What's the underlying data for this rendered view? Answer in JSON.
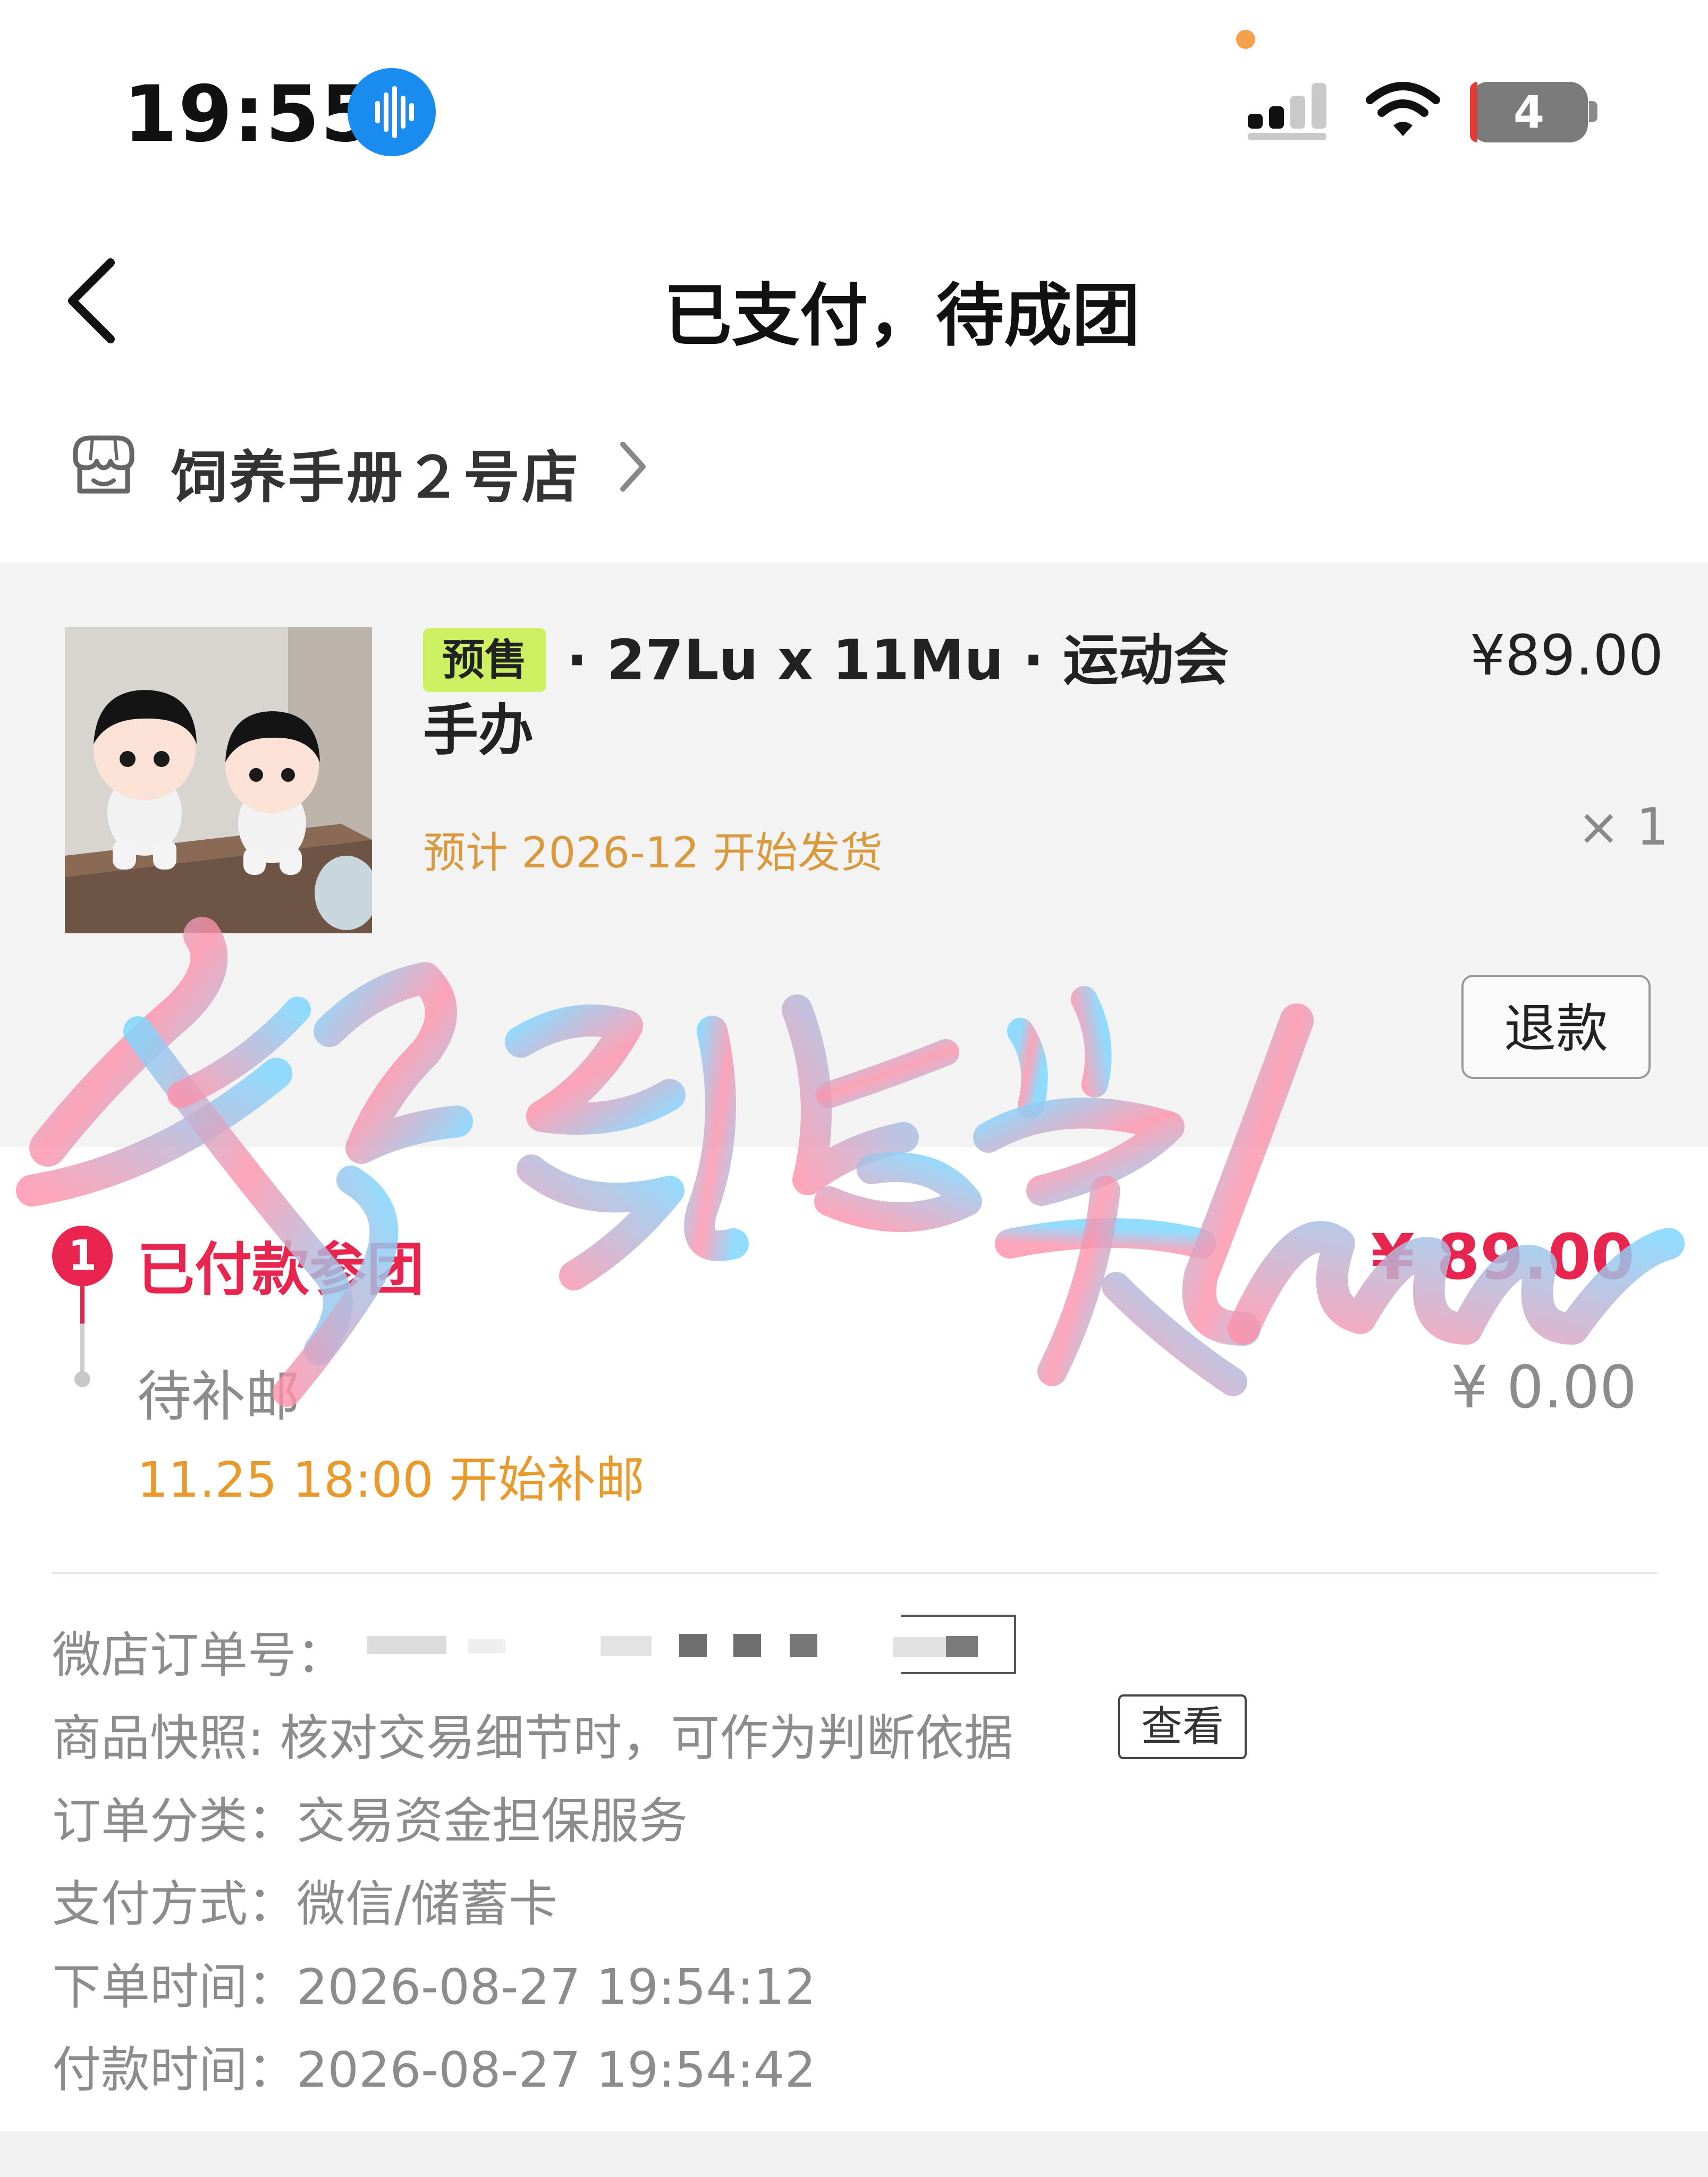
{
  "status_bar": {
    "time": "19:55",
    "battery_level": "4",
    "icons": [
      "voice-assistant-icon",
      "signal-icon",
      "wifi-icon",
      "battery-icon"
    ]
  },
  "nav": {
    "title": "已支付，待成团",
    "back_icon": "chevron-left-icon"
  },
  "shop": {
    "name": "饲养手册２号店",
    "icon": "storefront-icon"
  },
  "product": {
    "tag": "预售",
    "title": "· 27Lu x 11Mu · 运动会手办",
    "price": "¥89.00",
    "shipping_estimate": "预计 2026-12 开始发货",
    "quantity": "× 1",
    "refund_label": "退款"
  },
  "payment_steps": {
    "step1": {
      "number": "1",
      "label": "已付款参团",
      "amount": "¥ 89.00"
    },
    "step2": {
      "label": "待补邮",
      "amount": "¥ 0.00",
      "note": "11.25 18:00 开始补邮"
    }
  },
  "order_info": {
    "order_no_label": "微店订单号：",
    "snapshot_label": "商品快照: 核对交易细节时，可作为判断依据",
    "view_label": "查看",
    "category_label": "订单分类：",
    "category_value": "交易资金担保服务",
    "payment_method_label": "支付方式：",
    "payment_method_value": "微信/储蓄卡",
    "order_time_label": "下单时间：",
    "order_time_value": "2026-08-27 19:54:12",
    "pay_time_label": "付款时间：",
    "pay_time_value": "2026-08-27 19:54:42"
  },
  "colors": {
    "accent_red": "#e8254f",
    "accent_orange": "#e89a2c",
    "tag_green": "#ccf062",
    "voice_blue": "#1a8cf0"
  }
}
